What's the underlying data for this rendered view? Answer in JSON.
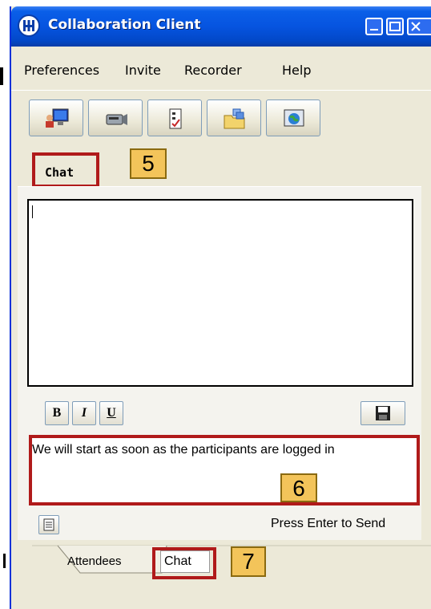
{
  "window": {
    "title": "Collaboration Client",
    "title_bar_color": "#0654e0"
  },
  "menu": {
    "items": [
      "Preferences",
      "Invite",
      "Recorder",
      "Help"
    ]
  },
  "toolbar": {
    "buttons": [
      "share-desktop-icon",
      "camera-icon",
      "poll-checklist-icon",
      "file-folder-icon",
      "web-browser-icon"
    ]
  },
  "tabs": {
    "top_chat": "Chat"
  },
  "callouts": {
    "five": "5",
    "six": "6",
    "seven": "7"
  },
  "chat": {
    "log_text": "",
    "format_bold": "B",
    "format_italic": "I",
    "format_underline": "U",
    "message": "We will start as soon as the participants are logged in",
    "send_hint": "Press Enter to Send"
  },
  "bottom_tabs": {
    "attendees": "Attendees",
    "chat": "Chat"
  },
  "colors": {
    "annotation_red": "#b01a1a",
    "callout_fill": "#f3c45a"
  }
}
